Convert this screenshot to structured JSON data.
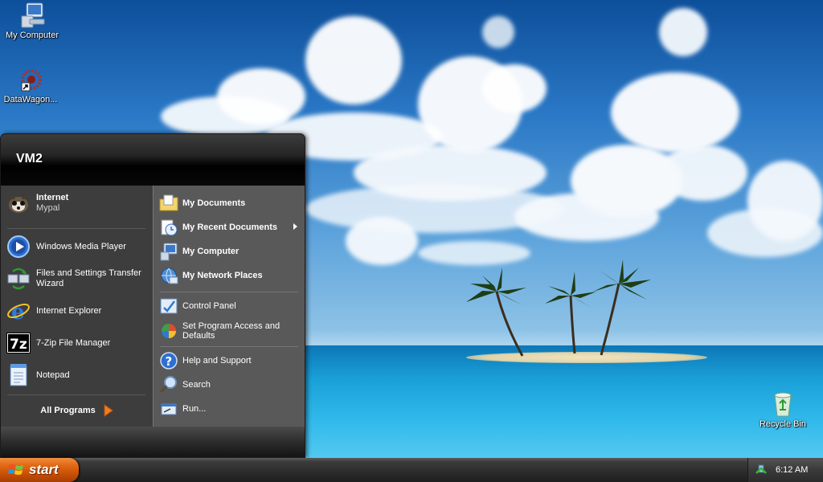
{
  "desktop": {
    "icons": [
      {
        "label": "My Computer",
        "icon": "my-computer-icon"
      },
      {
        "label": "DataWagon...",
        "icon": "datawagon-shortcut-icon"
      },
      {
        "label": "Recycle Bin",
        "icon": "recycle-bin-icon"
      }
    ]
  },
  "start_menu": {
    "user_name": "VM2",
    "pinned": [
      {
        "title": "Internet",
        "subtitle": "Mypal",
        "icon": "mypal-browser-icon"
      }
    ],
    "recent": [
      {
        "label": "Windows Media Player",
        "icon": "media-player-icon"
      },
      {
        "label": "Files and Settings Transfer Wizard",
        "icon": "transfer-wizard-icon"
      },
      {
        "label": "Internet Explorer",
        "icon": "internet-explorer-icon"
      },
      {
        "label": "7-Zip File Manager",
        "icon": "7zip-icon"
      },
      {
        "label": "Notepad",
        "icon": "notepad-icon"
      }
    ],
    "all_programs_label": "All Programs",
    "places": [
      {
        "label": "My Documents",
        "icon": "my-documents-icon",
        "bold": true
      },
      {
        "label": "My Recent Documents",
        "icon": "recent-documents-icon",
        "bold": true,
        "submenu": true
      },
      {
        "label": "My Computer",
        "icon": "my-computer-icon",
        "bold": true
      },
      {
        "label": "My Network Places",
        "icon": "network-places-icon",
        "bold": true
      }
    ],
    "settings": [
      {
        "label": "Control Panel",
        "icon": "control-panel-icon"
      },
      {
        "label": "Set Program Access and Defaults",
        "icon": "program-defaults-icon"
      }
    ],
    "tools": [
      {
        "label": "Help and Support",
        "icon": "help-icon"
      },
      {
        "label": "Search",
        "icon": "search-icon"
      },
      {
        "label": "Run...",
        "icon": "run-icon"
      }
    ]
  },
  "taskbar": {
    "start_label": "start",
    "clock": "6:12 AM",
    "tray_icon": "safely-remove-hardware-icon"
  },
  "colors": {
    "start_button": "#e26a16",
    "menu_left": "#3d3d3d",
    "menu_right": "#595959"
  }
}
